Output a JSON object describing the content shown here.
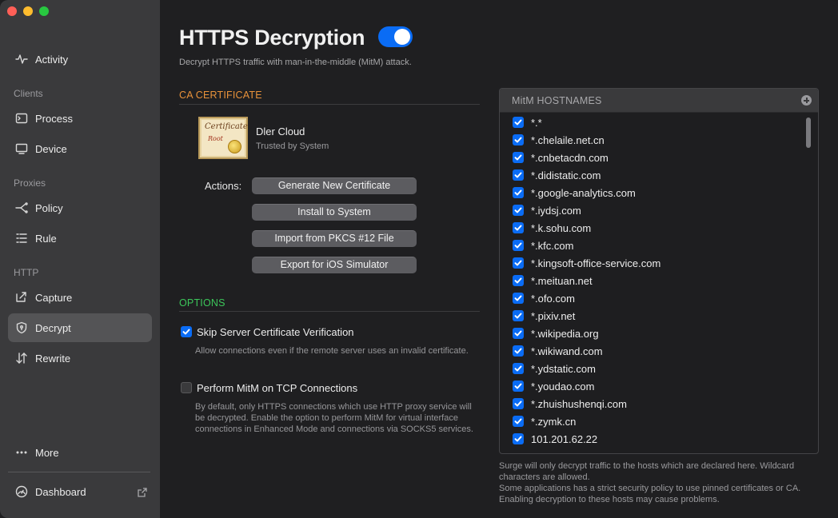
{
  "sidebar": {
    "items": [
      {
        "label": "Activity",
        "icon": "activity-icon"
      },
      {
        "label": "Process",
        "icon": "process-icon"
      },
      {
        "label": "Device",
        "icon": "device-icon"
      },
      {
        "label": "Policy",
        "icon": "policy-icon"
      },
      {
        "label": "Rule",
        "icon": "rule-icon"
      },
      {
        "label": "Capture",
        "icon": "capture-icon"
      },
      {
        "label": "Decrypt",
        "icon": "shield-icon",
        "active": true
      },
      {
        "label": "Rewrite",
        "icon": "rewrite-icon"
      },
      {
        "label": "More",
        "icon": "more-icon"
      },
      {
        "label": "Dashboard",
        "icon": "dashboard-icon"
      }
    ],
    "sections": {
      "clients": "Clients",
      "proxies": "Proxies",
      "http": "HTTP"
    }
  },
  "header": {
    "title": "HTTPS Decryption",
    "subtitle": "Decrypt HTTPS traffic with man-in-the-middle (MitM) attack.",
    "enabled": true
  },
  "ca": {
    "section_title": "CA CERTIFICATE",
    "image_text": "Certificate",
    "image_subtext": "Root",
    "name": "Dler Cloud",
    "status": "Trusted by System",
    "actions_label": "Actions:",
    "buttons": {
      "generate": "Generate New Certificate",
      "install": "Install to System",
      "import": "Import from PKCS #12 File",
      "export": "Export for iOS Simulator"
    }
  },
  "options": {
    "section_title": "OPTIONS",
    "skip_verify": {
      "label": "Skip Server Certificate Verification",
      "checked": true,
      "description": "Allow connections even if the remote server uses an invalid certificate."
    },
    "mitm_tcp": {
      "label": "Perform MitM on TCP Connections",
      "checked": false,
      "description": "By default, only HTTPS connections which use HTTP proxy service will be decrypted. Enable the option to perform MitM for virtual interface connections in Enhanced Mode and connections via SOCKS5 services."
    }
  },
  "hostnames": {
    "header": "MitM HOSTNAMES",
    "items": [
      "*.*",
      "*.chelaile.net.cn",
      "*.cnbetacdn.com",
      "*.didistatic.com",
      "*.google-analytics.com",
      "*.iydsj.com",
      "*.k.sohu.com",
      "*.kfc.com",
      "*.kingsoft-office-service.com",
      "*.meituan.net",
      "*.ofo.com",
      "*.pixiv.net",
      "*.wikipedia.org",
      "*.wikiwand.com",
      "*.ydstatic.com",
      "*.youdao.com",
      "*.zhuishushenqi.com",
      "*.zymk.cn",
      "101.201.62.22"
    ],
    "note": "Surge will only decrypt traffic to the hosts which are declared here. Wildcard characters are allowed.",
    "warning": "Some applications has a strict security policy to use pinned certificates or CA. Enabling decryption to these hosts may cause problems."
  },
  "colors": {
    "accent": "#0a6cf5",
    "ca_section": "#e8923a",
    "options_section": "#3cc65a"
  }
}
